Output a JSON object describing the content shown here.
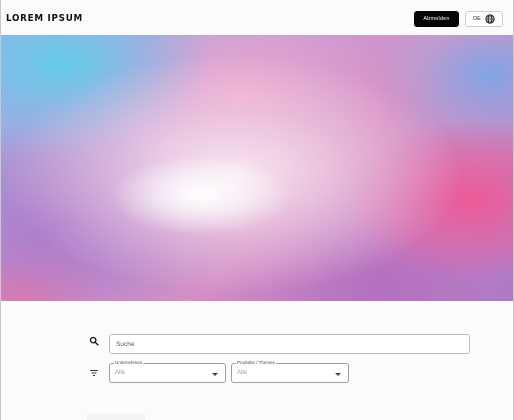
{
  "header": {
    "brand": "LOREM IPSUM",
    "logout_label": "Abmelden",
    "language": "DE",
    "language_icon": "globe-icon"
  },
  "hero": {
    "image": "abstract pastel gradient banner"
  },
  "search": {
    "icon": "search-icon",
    "placeholder": "Suche",
    "value": ""
  },
  "filters": {
    "icon": "filter-icon",
    "company": {
      "label": "Unternehmen",
      "value": "Alle"
    },
    "topic": {
      "label": "Produkte / Themen",
      "value": "Alle"
    }
  },
  "colors": {
    "header_bg": "#fbfbfd",
    "button_dark": "#050505",
    "content_bg": "#fafbfd"
  }
}
